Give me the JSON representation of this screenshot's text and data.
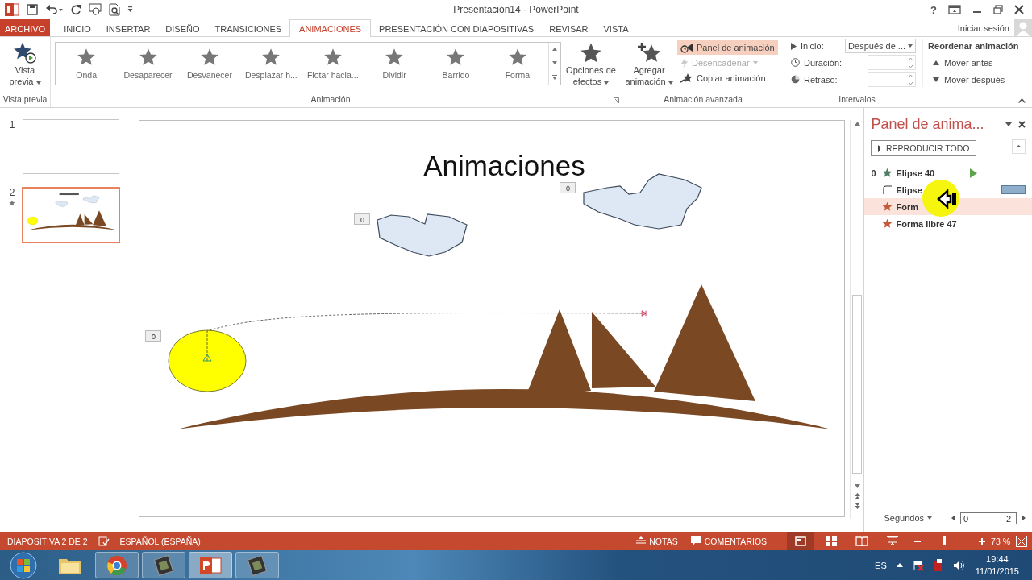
{
  "title_bar": {
    "title": "Presentación14 - PowerPoint",
    "help": "?"
  },
  "tabs": [
    {
      "label": "ARCHIVO",
      "kind": "file",
      "selected": false
    },
    {
      "label": "INICIO",
      "kind": "tab",
      "selected": false
    },
    {
      "label": "INSERTAR",
      "kind": "tab",
      "selected": false
    },
    {
      "label": "DISEÑO",
      "kind": "tab",
      "selected": false
    },
    {
      "label": "TRANSICIONES",
      "kind": "tab",
      "selected": false
    },
    {
      "label": "ANIMACIONES",
      "kind": "tab",
      "selected": true
    },
    {
      "label": "PRESENTACIÓN CON DIAPOSITIVAS",
      "kind": "tab",
      "selected": false
    },
    {
      "label": "REVISAR",
      "kind": "tab",
      "selected": false
    },
    {
      "label": "VISTA",
      "kind": "tab",
      "selected": false
    }
  ],
  "account": {
    "label": "Iniciar sesión"
  },
  "ribbon": {
    "preview": {
      "label": "Vista previa",
      "group": "Vista previa"
    },
    "gallery": {
      "group": "Animación",
      "items": [
        {
          "label": "Onda"
        },
        {
          "label": "Desaparecer"
        },
        {
          "label": "Desvanecer"
        },
        {
          "label": "Desplazar h..."
        },
        {
          "label": "Flotar hacia..."
        },
        {
          "label": "Dividir"
        },
        {
          "label": "Barrido"
        },
        {
          "label": "Forma"
        }
      ]
    },
    "effect_options": {
      "label": "Opciones de efectos"
    },
    "add_animation": {
      "label": "Agregar animación"
    },
    "advanced": {
      "group": "Animación avanzada",
      "items": [
        {
          "label": "Panel de animación",
          "kind": "pane",
          "selected": true,
          "disabled": false
        },
        {
          "label": "Desencadenar",
          "kind": "trigger",
          "selected": false,
          "disabled": true
        },
        {
          "label": "Copiar animación",
          "kind": "painter",
          "selected": false,
          "disabled": false
        }
      ]
    },
    "timing": {
      "group": "Intervalos",
      "start_label": "Inicio:",
      "start_value": "Después de ...",
      "duration_label": "Duración:",
      "delay_label": "Retraso:",
      "reorder_title": "Reordenar animación",
      "move_earlier": "Mover antes",
      "move_later": "Mover después"
    }
  },
  "thumbnails": [
    {
      "number": "1",
      "selected": false,
      "animated": false
    },
    {
      "number": "2",
      "selected": true,
      "animated": true
    }
  ],
  "slide": {
    "title": "Animaciones",
    "tags": [
      "0",
      "0",
      "0"
    ]
  },
  "animation_pane": {
    "title": "Panel de anima...",
    "play_all": "REPRODUCIR TODO",
    "items": [
      {
        "order": "0",
        "name": "Elipse 40",
        "kind": "entrance",
        "marker": {
          "kind": "play"
        },
        "selected": false
      },
      {
        "name": "Elipse",
        "kind": "motion",
        "marker": {
          "kind": "bar"
        },
        "selected": false
      },
      {
        "name": "Form",
        "kind": "exit",
        "selected": true
      },
      {
        "name": "Forma libre 47",
        "kind": "exit",
        "selected": false
      }
    ],
    "footer": {
      "units": "Segundos",
      "tick_start": "0",
      "tick_end": "2"
    }
  },
  "status_bar": {
    "slide_info": "DIAPOSITIVA 2 DE 2",
    "language": "ESPAÑOL (ESPAÑA)",
    "notes": "NOTAS",
    "comments": "COMENTARIOS",
    "views": [
      {
        "kind": "normal",
        "selected": true
      },
      {
        "kind": "sorter",
        "selected": false
      },
      {
        "kind": "reading",
        "selected": false
      },
      {
        "kind": "slideshow",
        "selected": false
      }
    ],
    "zoom": {
      "level": 0.38,
      "label": "73 %"
    }
  },
  "taskbar": {
    "apps": [
      {
        "kind": "folder",
        "open": false,
        "selected": false
      },
      {
        "kind": "browser",
        "open": true,
        "selected": false
      },
      {
        "kind": "tool",
        "open": true,
        "selected": false
      },
      {
        "kind": "slides",
        "open": true,
        "selected": true
      },
      {
        "kind": "tool",
        "open": true,
        "selected": false
      }
    ],
    "language": "ES",
    "time": "19:44",
    "date": "11/01/2015"
  }
}
